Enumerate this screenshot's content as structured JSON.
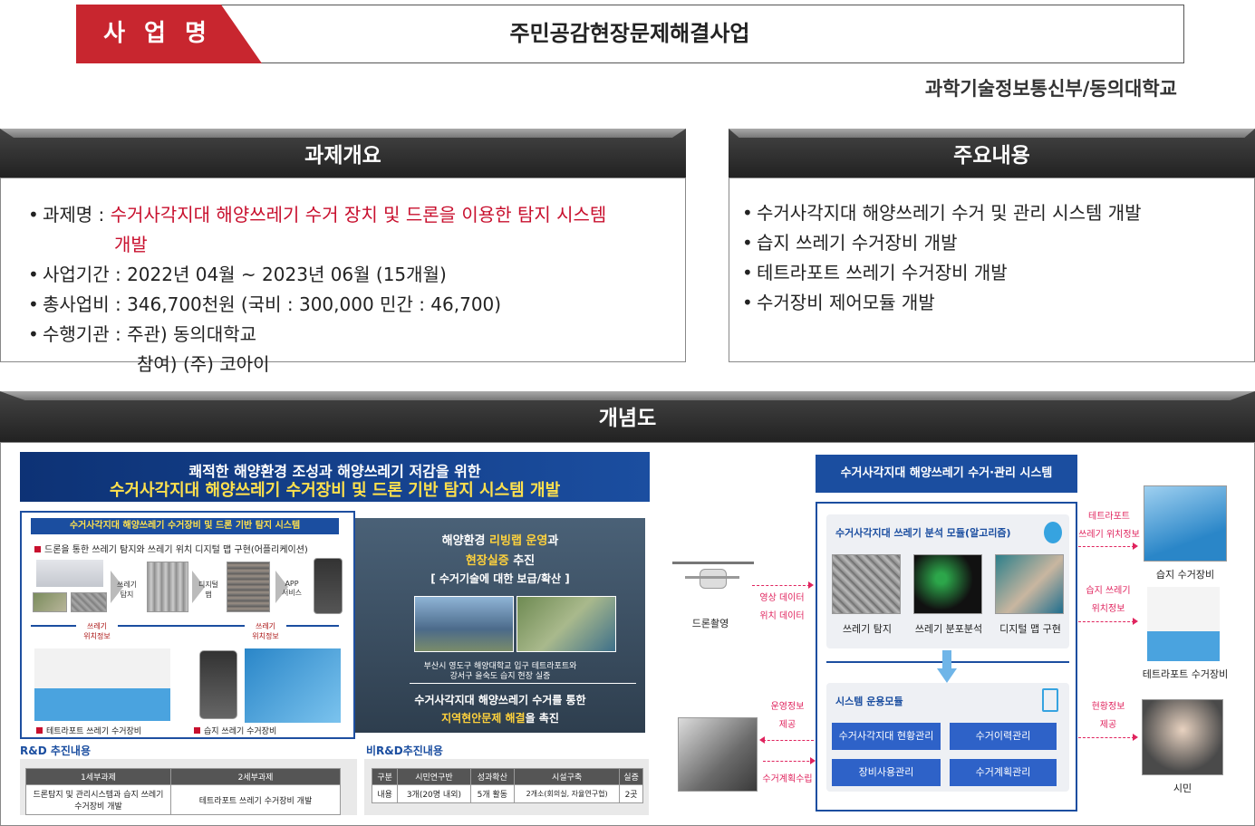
{
  "header": {
    "tag": "사 업 명",
    "title": "주민공감현장문제해결사업",
    "organization": "과학기술정보통신부/동의대학교"
  },
  "overview": {
    "heading": "과제개요",
    "items": [
      {
        "label": "과제명 : ",
        "value": "수거사각지대 해양쓰레기 수거 장치 및 드론을 이용한 탐지 시스템",
        "value2": "개발"
      },
      {
        "label": "사업기간 : ",
        "value": "2022년 04월 ~ 2023년 06월 (15개월)"
      },
      {
        "label": "총사업비 : ",
        "value": "346,700천원 (국비 : 300,000   민간 : 46,700)"
      },
      {
        "label": "수행기관 : ",
        "value": "주관) 동의대학교",
        "value2": "참여) (주) 코아이"
      }
    ]
  },
  "main_content": {
    "heading": "주요내용",
    "items": [
      "수거사각지대 해양쓰레기 수거 및 관리 시스템 개발",
      "습지 쓰레기 수거장비 개발",
      "테트라포트 쓰레기 수거장비 개발",
      "수거장비 제어모듈 개발"
    ]
  },
  "concept": {
    "heading": "개념도",
    "left": {
      "banner_line1": "쾌적한 해양환경 조성과 해양쓰레기 저감을 위한",
      "banner_line2": "수거사각지대 해양쓰레기 수거장비 및 드론 기반 탐지 시스템 개발",
      "sub_title": "수거사각지대 해양쓰레기 수거장비 및 드론 기반 탐지 시스템",
      "sub_caption": "드론을 통한 쓰레기 탐지와 쓰레기 위치 디지털 맵 구현(어플리케이션)",
      "flow": [
        "쓰레기\n탐지",
        "디지털\n맵",
        "APP\n서비스"
      ],
      "pos1": "쓰레기\n위치정보",
      "pos2": "쓰레기\n위치정보",
      "cap_tetrapod": "테트라포트 쓰레기 수거장비",
      "cap_wetland": "습지 쓰레기 수거장비",
      "mid_line1a": "해양환경 ",
      "mid_line1b": "리빙랩 운영",
      "mid_line1c": "과",
      "mid_line2a": "현장실증",
      "mid_line2b": " 추진",
      "mid_line3": "[ 수거기술에 대한 보급/확산 ]",
      "mid_caption1": "부산시 영도구 해양대학교 입구 테트라포트와",
      "mid_caption2": "강서구 을숙도 습지 현장 실증",
      "mid_bottom1": "수거사각지대 해양쓰레기 수거를 통한",
      "mid_bottom2a": "지역현안문제 해결",
      "mid_bottom2b": "을 촉진",
      "rd_title": "R&D 추진내용",
      "rd_headers": [
        "1세부과제",
        "2세부과제"
      ],
      "rd_row": [
        "드론탐지 및 관리시스템과 습지 쓰레기 수거장비 개발",
        "테트라포트 쓰레기 수거장비 개발"
      ],
      "nonrd_title": "비R&D추진내용",
      "nonrd_headers": [
        "구분",
        "시민연구반",
        "성과확산",
        "시설구축",
        "실증"
      ],
      "nonrd_row": [
        "내용",
        "3개(20명 내외)",
        "5개 활동",
        "2개소(회의실, 자율연구협)",
        "2곳"
      ]
    },
    "right": {
      "system_title": "수거사각지대 해양쓰레기 수거·관리 시스템",
      "analysis_title": "수거사각지대 쓰레기 분석 모듈(알고리즘)",
      "analysis_items": [
        "쓰레기 탐지",
        "쓰레기 분포분석",
        "디지털 맵 구현"
      ],
      "ops_title": "시스템 운용모듈",
      "ops_buttons": [
        "수거사각지대 현황관리",
        "수거이력관리",
        "장비사용관리",
        "수거계획관리"
      ],
      "drone_label": "드론촬영",
      "drone_data1": "영상 데이터",
      "drone_data2": "위치 데이터",
      "ops_info1": "운영정보",
      "ops_info2": "제공",
      "plan": "수거계획수립",
      "tetra_info1": "테트라포트",
      "tetra_info2": "쓰레기 위치정보",
      "wet_info1": "습지 쓰레기",
      "wet_info2": "위치정보",
      "status_info1": "현황정보",
      "status_info2": "제공",
      "wet_device": "습지 수거장비",
      "tetra_device": "테트라포트 수거장비",
      "citizen": "시민"
    }
  }
}
